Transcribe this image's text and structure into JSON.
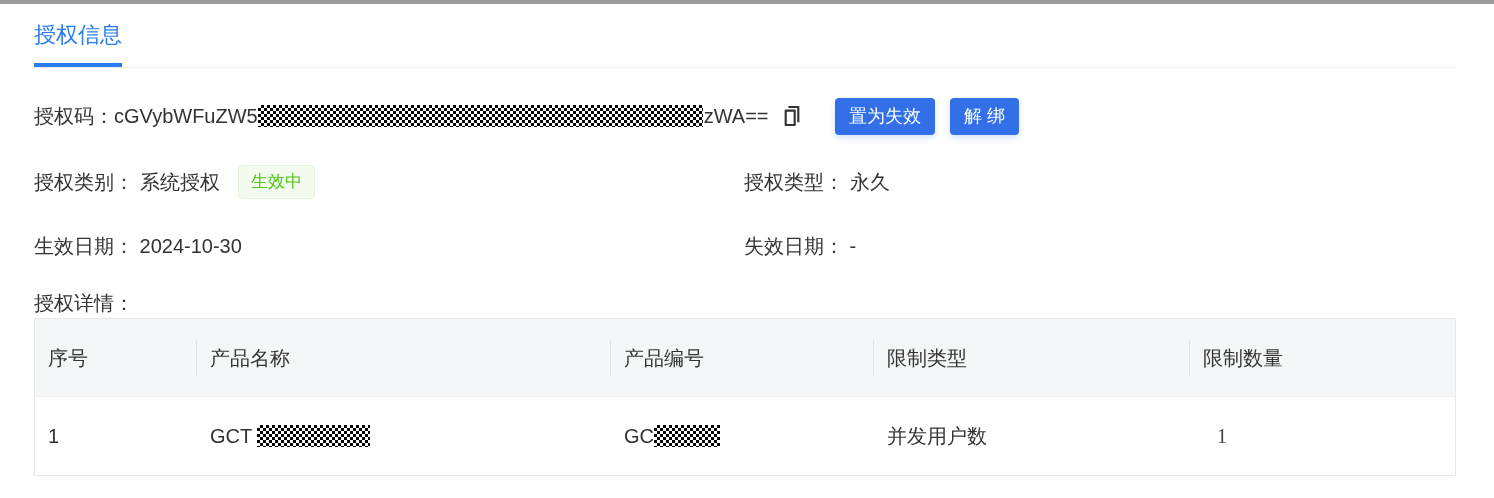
{
  "tabs": [
    {
      "label": "授权信息",
      "selected": true
    }
  ],
  "license_code": {
    "label": "授权码：",
    "value_start": "cGVybWFuZW5",
    "redacted": true,
    "value_end": "zWA=="
  },
  "buttons": [
    {
      "label": "置为失效"
    },
    {
      "label": "解 绑"
    }
  ],
  "field_rows": [
    {
      "left": {
        "label": "授权类别：",
        "value": "系统授权",
        "badge": "生效中"
      },
      "right": {
        "label": "授权类型：",
        "value": "永久"
      }
    },
    {
      "left": {
        "label": "生效日期：",
        "value": "2024-10-30"
      },
      "right": {
        "label": "失效日期：",
        "value": "-"
      }
    }
  ],
  "details_label": "授权详情：",
  "table": {
    "columns": [
      "序号",
      "产品名称",
      "产品编号",
      "限制类型",
      "限制数量"
    ],
    "rows": [
      {
        "cells": [
          {
            "text": "1"
          },
          {
            "text": "GCT ",
            "redacted": true
          },
          {
            "text": "GC",
            "redacted": true
          },
          {
            "text": "并发用户数"
          },
          {
            "text": "1",
            "kind": "serif"
          }
        ]
      }
    ]
  }
}
